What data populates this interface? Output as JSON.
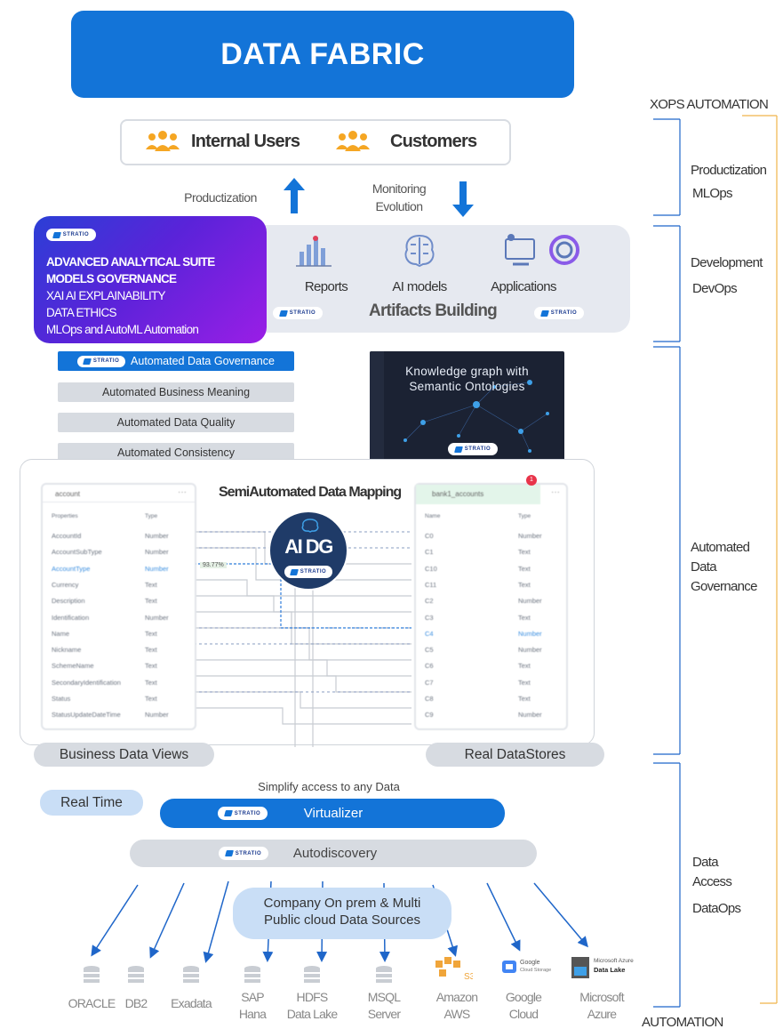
{
  "title": "DATA FABRIC",
  "users": {
    "internal": "Internal Users",
    "customers": "Customers"
  },
  "arrows": {
    "productization": "Productization",
    "monitoring": "Monitoring",
    "evolution": "Evolution"
  },
  "brand": "STRATIO",
  "suite": {
    "lines": [
      "ADVANCED ANALYTICAL SUITE",
      "MODELS GOVERNANCE",
      "XAI AI EXPLAINABILITY",
      "DATA ETHICS",
      "MLOps and AutoML Automation"
    ]
  },
  "artifacts": {
    "title": "Artifacts Building",
    "items": [
      "Reports",
      "AI models",
      "Applications"
    ]
  },
  "governance": {
    "items": [
      "Automated Data Governance",
      "Automated Business Meaning",
      "Automated Data Quality",
      "Automated Consistency"
    ]
  },
  "knowledge_graph": {
    "line1": "Knowledge graph with",
    "line2": "Semantic Ontologies"
  },
  "mapping": {
    "title": "SemiAutomated Data Mapping",
    "aidg": "AI DG",
    "percent": "93.77%",
    "badge": "1",
    "left_table": {
      "name": "account",
      "col1": "Properties",
      "col2": "Type",
      "rows": [
        [
          "AccountId",
          "Number"
        ],
        [
          "AccountSubType",
          "Number"
        ],
        [
          "AccountType",
          "Number"
        ],
        [
          "Currency",
          "Text"
        ],
        [
          "Description",
          "Text"
        ],
        [
          "Identification",
          "Number"
        ],
        [
          "Name",
          "Text"
        ],
        [
          "Nickname",
          "Text"
        ],
        [
          "SchemeName",
          "Text"
        ],
        [
          "SecondaryIdentification",
          "Text"
        ],
        [
          "Status",
          "Text"
        ],
        [
          "StatusUpdateDateTime",
          "Number"
        ]
      ]
    },
    "right_table": {
      "name": "bank1_accounts",
      "col1": "Name",
      "col2": "Type",
      "rows": [
        [
          "C0",
          "Number"
        ],
        [
          "C1",
          "Text"
        ],
        [
          "C10",
          "Text"
        ],
        [
          "C11",
          "Text"
        ],
        [
          "C2",
          "Number"
        ],
        [
          "C3",
          "Text"
        ],
        [
          "C4",
          "Number"
        ],
        [
          "C5",
          "Number"
        ],
        [
          "C6",
          "Text"
        ],
        [
          "C7",
          "Text"
        ],
        [
          "C8",
          "Text"
        ],
        [
          "C9",
          "Number"
        ]
      ]
    }
  },
  "views": {
    "business": "Business Data Views",
    "stores": "Real DataStores"
  },
  "access": {
    "simplify": "Simplify access to any Data",
    "real_time": "Real Time",
    "virtualizer": "Virtualizer",
    "autodiscovery": "Autodiscovery",
    "sources_line1": "Company On prem & Multi",
    "sources_line2": "Public cloud Data Sources"
  },
  "sources": [
    {
      "label": "ORACLE"
    },
    {
      "label": "DB2"
    },
    {
      "label": "Exadata"
    },
    {
      "label": "SAP",
      "label2": "Hana"
    },
    {
      "label": "HDFS",
      "label2": "Data Lake"
    },
    {
      "label": "MSQL",
      "label2": "Server"
    },
    {
      "label": "Amazon",
      "label2": "AWS"
    },
    {
      "label": "Google",
      "label2": "Cloud"
    },
    {
      "label": "Microsoft",
      "label2": "Azure"
    }
  ],
  "cloud_logos": {
    "s3": "S3",
    "google": "Google",
    "google_sub": "Cloud Storage",
    "azure": "Microsoft Azure",
    "azure_sub": "Data Lake"
  },
  "side": {
    "xops": "XOPS AUTOMATION",
    "productization": "Productization",
    "mlops": "MLOps",
    "development": "Development",
    "devops": "DevOps",
    "gov1": "Automated",
    "gov2": "Data",
    "gov3": "Governance",
    "access1": "Data",
    "access2": "Access",
    "dataops": "DataOps",
    "automation": "AUTOMATION"
  },
  "colors": {
    "primary": "#1374d8",
    "grey": "#d7dbe1",
    "purple": "#7a22e0",
    "orange": "#f0b44a"
  }
}
